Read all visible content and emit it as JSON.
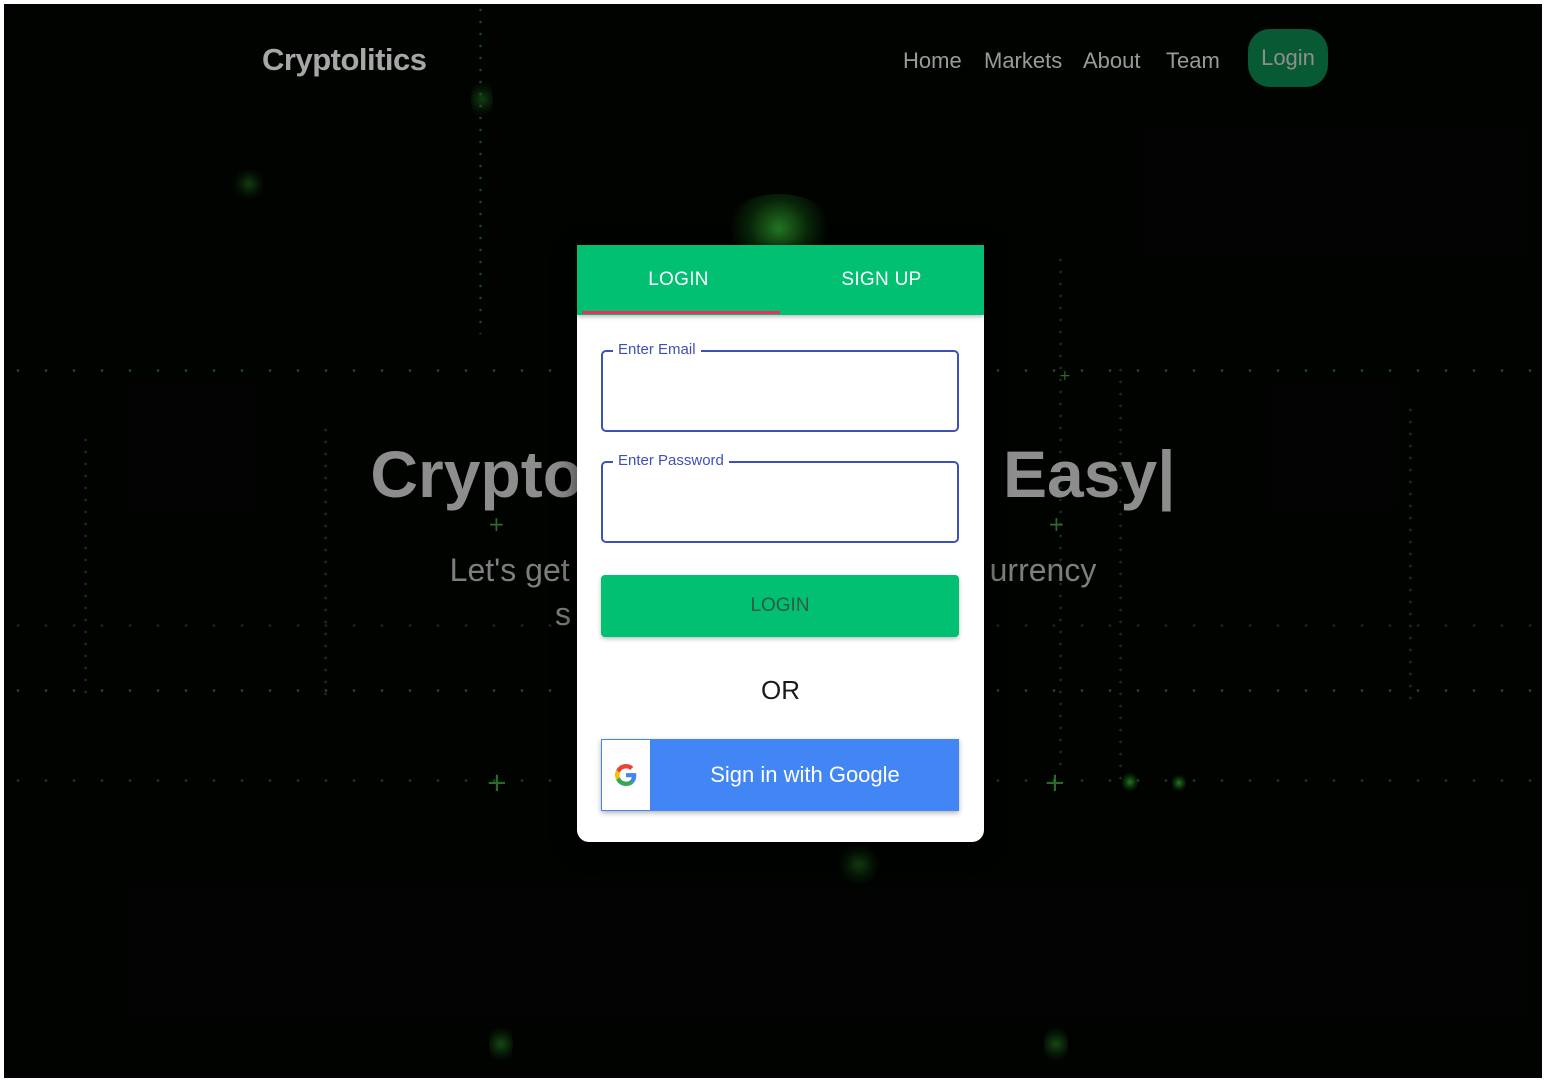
{
  "navbar": {
    "brand": "Cryptolitics",
    "links": [
      "Home",
      "Markets",
      "About",
      "Team"
    ],
    "login_label": "Login"
  },
  "hero": {
    "title_left": "Crypto",
    "title_right": "Easy|",
    "subtitle_left": "Let's get",
    "subtitle_right": "urrency",
    "subtitle_line2": "s"
  },
  "modal": {
    "tabs": [
      "LOGIN",
      "SIGN UP"
    ],
    "active_tab": "LOGIN",
    "email_label": "Enter Email",
    "password_label": "Enter Password",
    "login_button": "LOGIN",
    "or_text": "OR",
    "google_button": "Sign in with Google"
  },
  "colors": {
    "accent_green": "#02c071",
    "tab_indicator": "#e8305e",
    "field_outline": "#3f51b5",
    "google_blue": "#4285f4",
    "nav_login_bg": "#075a34"
  }
}
